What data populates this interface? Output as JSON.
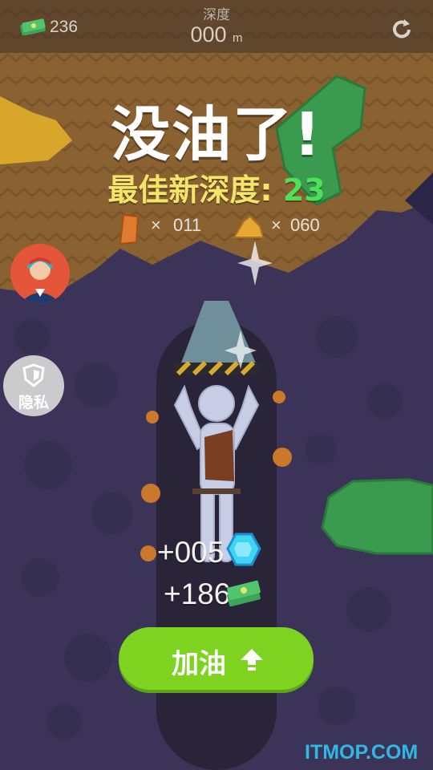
{
  "hud": {
    "cash": "236",
    "depth_label": "深度",
    "depth_value": "000",
    "depth_unit": "m"
  },
  "result": {
    "title": "没油了!",
    "best_label": "最佳新深度:",
    "best_value": "23",
    "ore_count": "011",
    "gold_count": "060",
    "multiply": "×"
  },
  "side": {
    "privacy_label": "隐私"
  },
  "rewards": {
    "gems": "+005",
    "cash": "+186"
  },
  "button": {
    "refuel_label": "加油"
  },
  "watermark": "ITMOP.COM",
  "colors": {
    "accent_green": "#7ed321",
    "best_yellow": "#f3e46a",
    "best_green": "#4fe05a",
    "soil": "#8a6232",
    "rock": "#3b3458"
  }
}
